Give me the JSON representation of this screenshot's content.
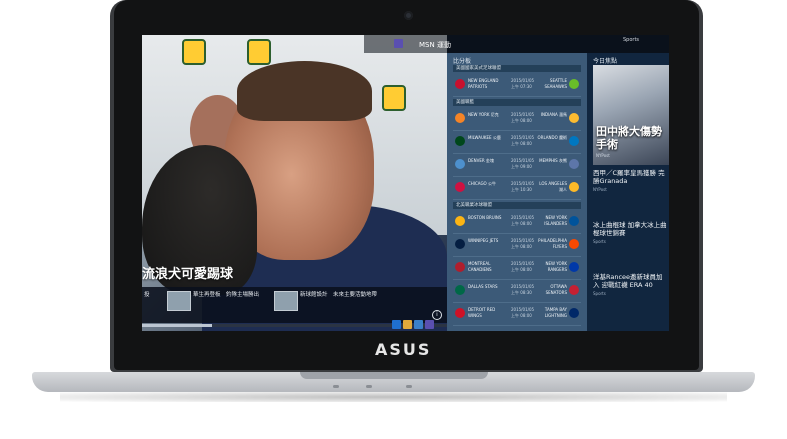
{
  "device": {
    "logo": "ASUS"
  },
  "topbar": {
    "app_title": "MSN 運動",
    "section_label": "Sports"
  },
  "hero": {
    "headline": "流浪犬可愛踢球",
    "strip_items": [
      {
        "text": "投"
      },
      {
        "text": "華生再登板　釣隊主場勝出"
      },
      {
        "text": "新球館設計　未來主要活動地帶"
      }
    ],
    "progress": 0.23
  },
  "schedule": {
    "title": "比分板",
    "sections": [
      {
        "label": "美國國家美式足球聯盟",
        "games": [
          {
            "away": "NEW ENGLAND PATRIOTS",
            "time": "2015/01/05 上午 07:30",
            "home": "SEATTLE SEAHAWKS",
            "away_color": "#c8102e",
            "home_color": "#69be28"
          }
        ]
      },
      {
        "label": "美國職籃",
        "games": [
          {
            "away": "NEW YORK 尼克",
            "time": "2015/01/05 上午 08:00",
            "home": "INDIANA 溜馬",
            "away_color": "#f58426",
            "home_color": "#fdbb30"
          },
          {
            "away": "MILWAUKEE 公鹿",
            "time": "2015/01/05 上午 08:00",
            "home": "ORLANDO 魔術",
            "away_color": "#00471b",
            "home_color": "#0077c0"
          },
          {
            "away": "DENVER 金塊",
            "time": "2015/01/05 上午 09:00",
            "home": "MEMPHIS 灰熊",
            "away_color": "#4d90cd",
            "home_color": "#5d76a9"
          },
          {
            "away": "CHICAGO 公牛",
            "time": "2015/01/05 上午 10:30",
            "home": "LOS ANGELES 湖人",
            "away_color": "#ce1141",
            "home_color": "#fdb927"
          }
        ]
      },
      {
        "label": "北美職業冰球聯盟",
        "games": [
          {
            "away": "BOSTON BRUINS",
            "time": "2015/01/05 上午 08:00",
            "home": "NEW YORK ISLANDERS",
            "away_color": "#fcb514",
            "home_color": "#00539b"
          },
          {
            "away": "WINNIPEG JETS",
            "time": "2015/01/05 上午 08:00",
            "home": "PHILADELPHIA FLYERS",
            "away_color": "#041e42",
            "home_color": "#f74902"
          },
          {
            "away": "MONTREAL CANADIENS",
            "time": "2015/01/05 上午 08:00",
            "home": "NEW YORK RANGERS",
            "away_color": "#af1e2d",
            "home_color": "#0038a8"
          },
          {
            "away": "DALLAS STARS",
            "time": "2015/01/05 上午 08:30",
            "home": "OTTAWA SENATORS",
            "away_color": "#006847",
            "home_color": "#c52032"
          },
          {
            "away": "DETROIT RED WINGS",
            "time": "2015/01/05 上午 08:00",
            "home": "TAMPA BAY LIGHTNING",
            "away_color": "#ce1126",
            "home_color": "#002868"
          }
        ]
      }
    ]
  },
  "news": {
    "header": "今日焦點",
    "feature_title": "田中將大傷勢手術",
    "feature_source": "NYPost",
    "items": [
      {
        "title": "西甲／C羅率皇馬獲勝 完勝Granada",
        "source": "NYPost"
      },
      {
        "title": "冰上曲棍球 加拿大冰上曲棍球世錦賽",
        "source": "Sports"
      },
      {
        "title": "洋基Rancee邀新球員加入 迎戰紅襪 ERA 40",
        "source": "Sports"
      }
    ]
  },
  "colors": {
    "schedule_bg": "#3c5a78",
    "news_bg": "#11263f",
    "accent": "#5a4fb0"
  }
}
